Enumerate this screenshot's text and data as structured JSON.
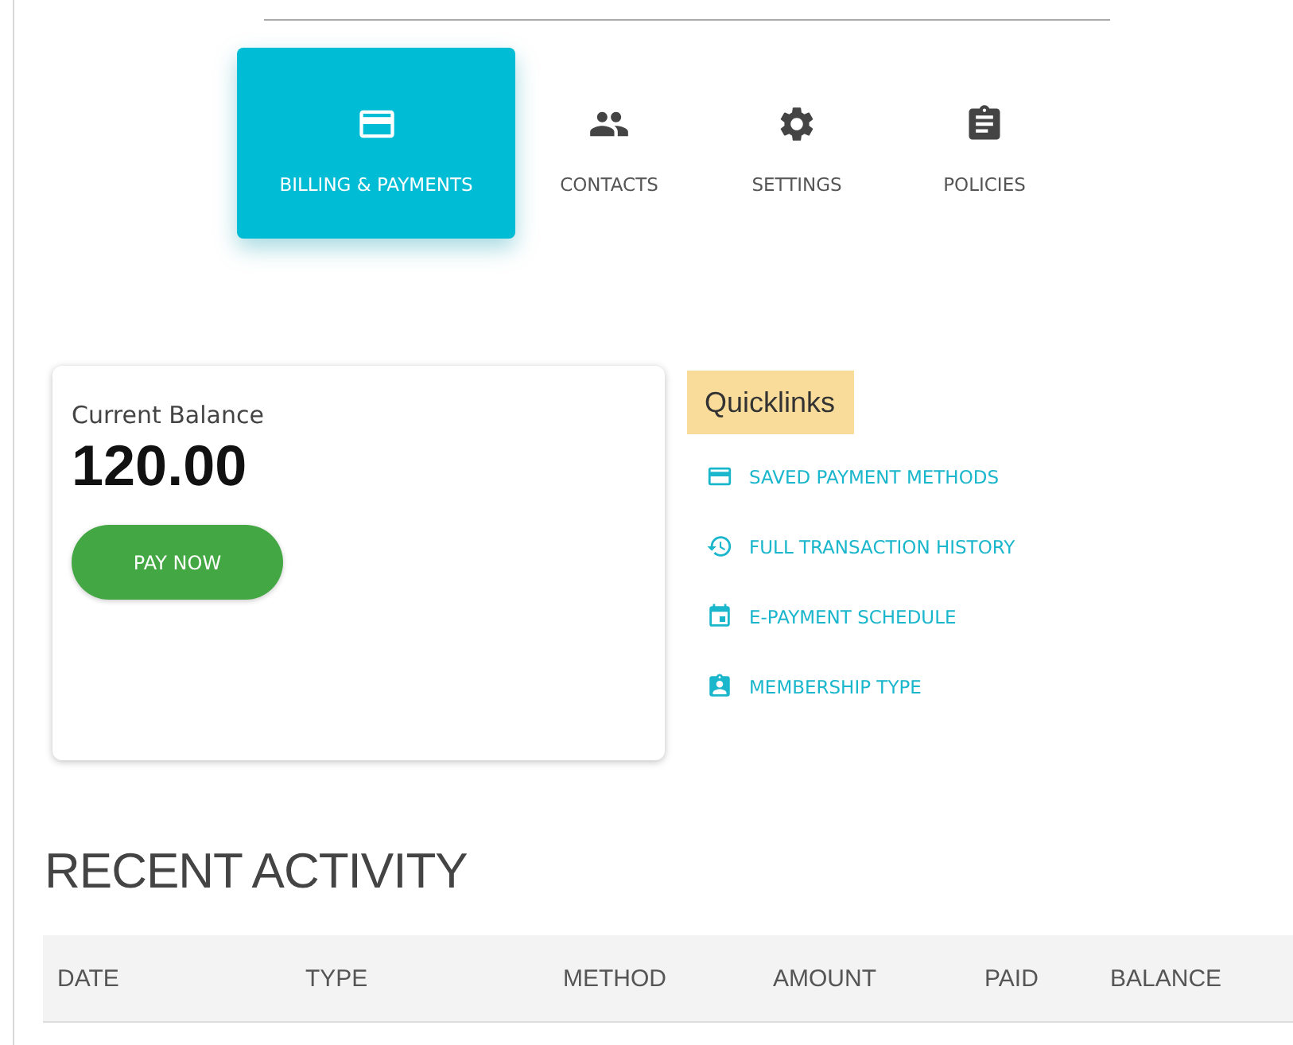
{
  "tabs": [
    {
      "label": "BILLING & PAYMENTS",
      "kind": "card",
      "selected": true
    },
    {
      "label": "CONTACTS",
      "kind": "people",
      "selected": false
    },
    {
      "label": "SETTINGS",
      "kind": "gear",
      "selected": false
    },
    {
      "label": "POLICIES",
      "kind": "clipboard",
      "selected": false
    }
  ],
  "balance_card": {
    "label": "Current Balance",
    "amount": "120.00",
    "button": "PAY NOW"
  },
  "quicklinks": {
    "title": "Quicklinks",
    "links": [
      {
        "label": "SAVED PAYMENT METHODS",
        "kind": "card"
      },
      {
        "label": "FULL TRANSACTION HISTORY",
        "kind": "history"
      },
      {
        "label": "E-PAYMENT SCHEDULE",
        "kind": "calendar"
      },
      {
        "label": "MEMBERSHIP TYPE",
        "kind": "badge"
      }
    ]
  },
  "recent_activity": {
    "title": "RECENT ACTIVITY",
    "columns": [
      "DATE",
      "TYPE",
      "METHOD",
      "AMOUNT",
      "PAID",
      "BALANCE"
    ]
  }
}
